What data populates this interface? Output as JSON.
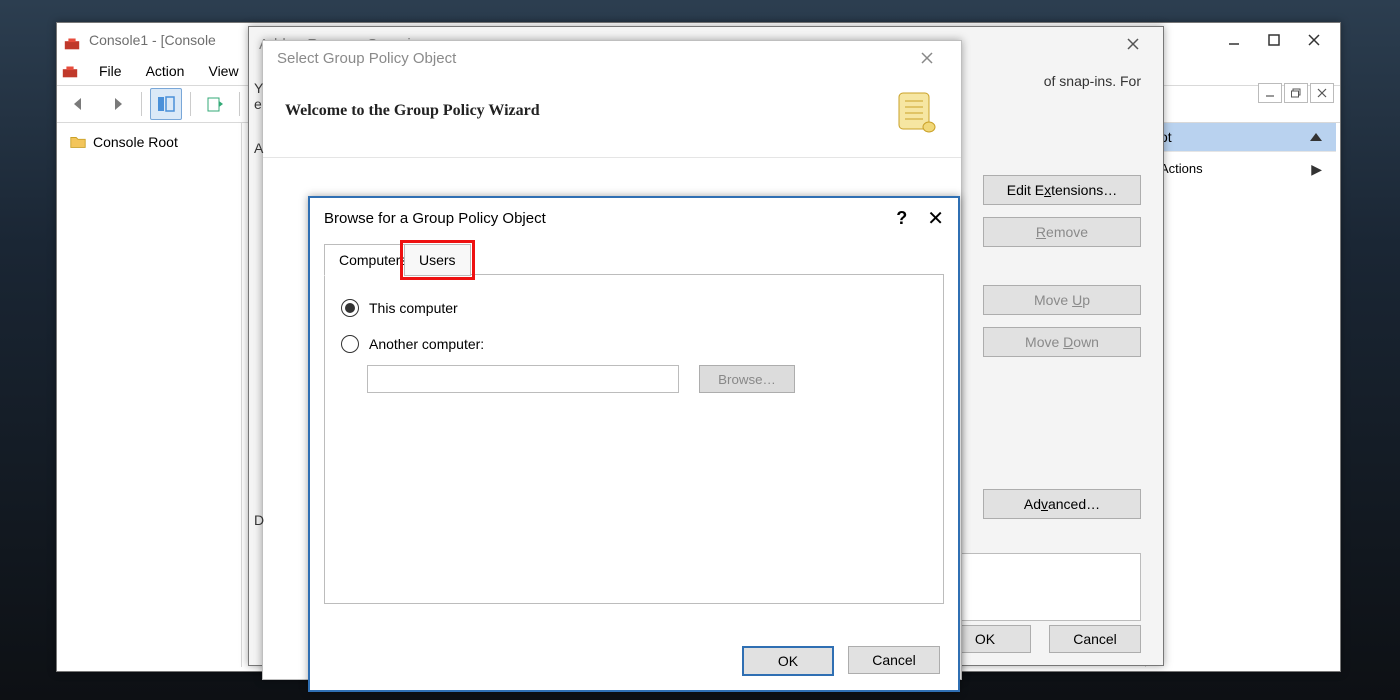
{
  "main": {
    "title": "Console1 - [Console",
    "menu": {
      "file": "File",
      "action": "Action",
      "view": "View"
    },
    "tree": {
      "root": "Console Root"
    },
    "actions": {
      "header": "ot",
      "more": "Actions"
    }
  },
  "snap": {
    "title": "Add or Remove Snap-ins",
    "blurb_tail": "of snap-ins. For",
    "letters": {
      "y": "Y",
      "e": "e",
      "a": "A",
      "d": "D"
    },
    "buttons": {
      "editext": "Edit Extensions…",
      "remove": "Remove",
      "moveup": "Move Up",
      "movedown": "Move Down",
      "advanced": "Advanced…",
      "ok": "OK",
      "cancel": "Cancel"
    },
    "desc": "Description:"
  },
  "wizard": {
    "title": "Select Group Policy Object",
    "header": "Welcome to the Group Policy Wizard"
  },
  "browse": {
    "title": "Browse for a Group Policy Object",
    "tabs": {
      "computers": "Computers",
      "users": "Users"
    },
    "radios": {
      "this": "This computer",
      "another": "Another computer:"
    },
    "browse": "Browse…",
    "ok": "OK",
    "cancel": "Cancel"
  }
}
